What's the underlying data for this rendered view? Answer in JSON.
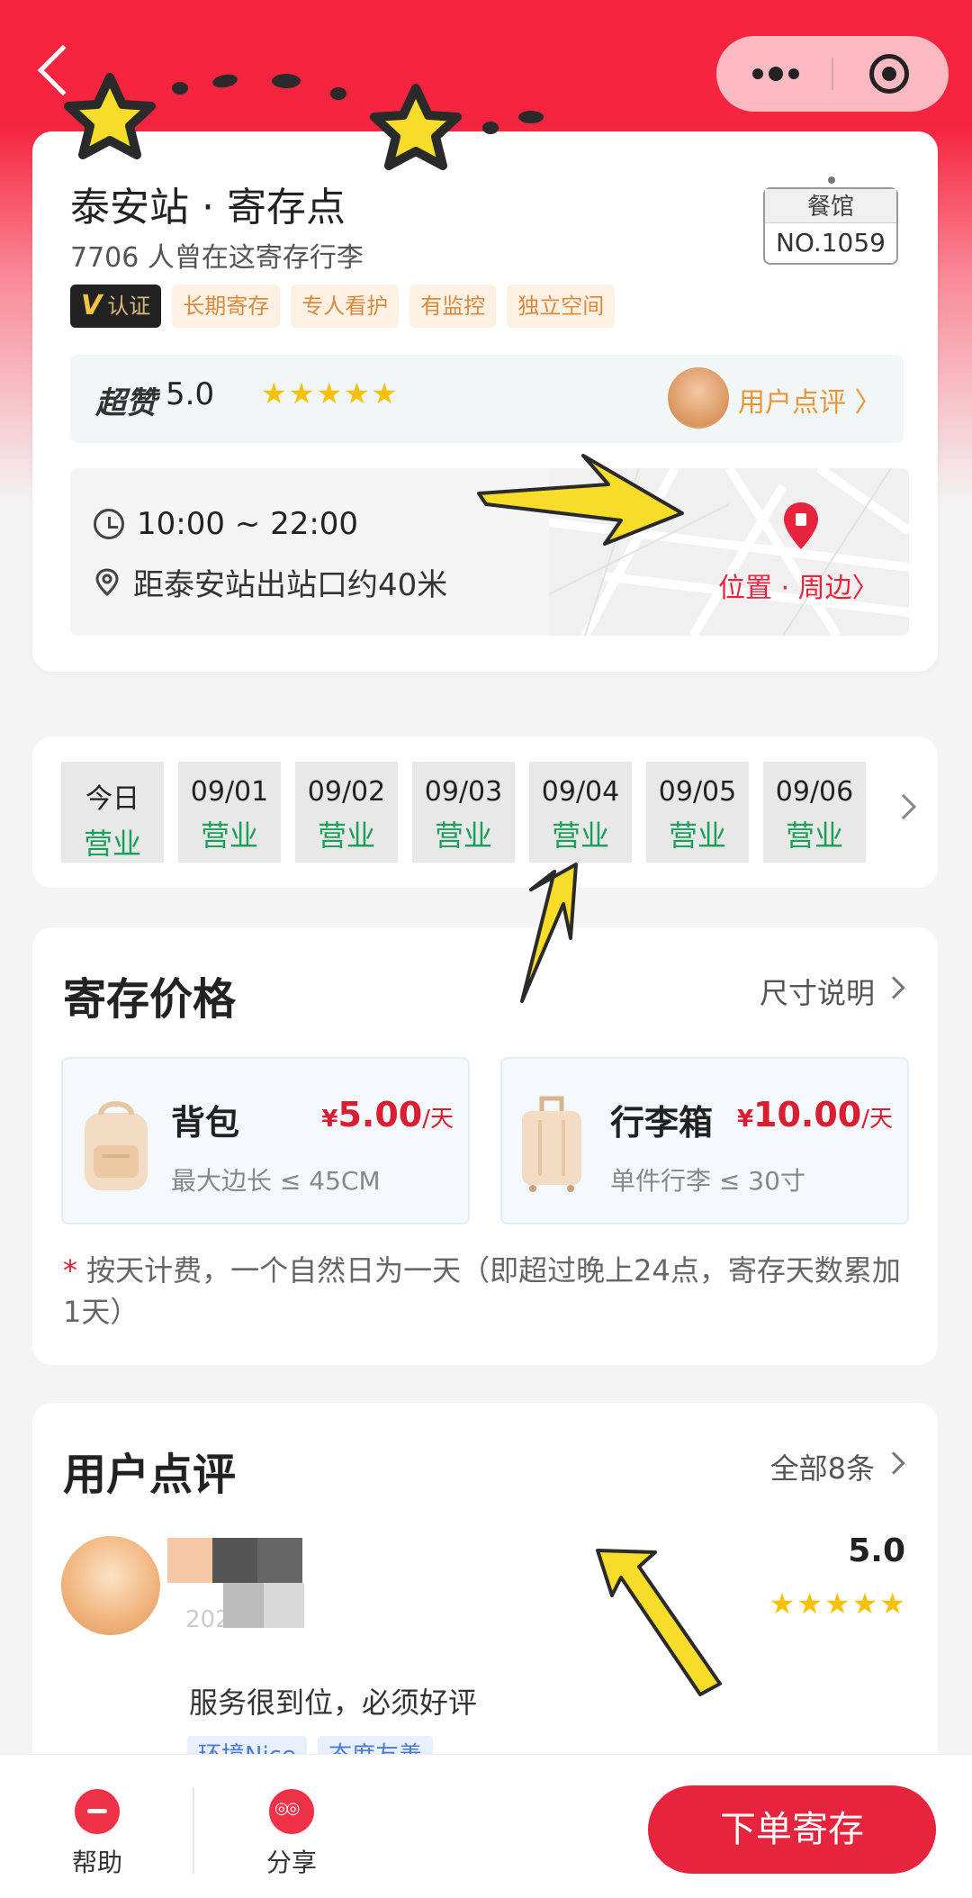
{
  "nav": {
    "back_icon": "back-arrow-icon",
    "more_icon": "more-dots-icon",
    "close_icon": "target-circle-icon"
  },
  "store": {
    "title": "泰安站 · 寄存点",
    "subtitle": "7706 人曾在这寄存行李",
    "verified_label": "认证",
    "tags": [
      "长期寄存",
      "专人看护",
      "有监控",
      "独立空间"
    ],
    "badge_top": "餐馆",
    "badge_no": "NO.1059"
  },
  "rating": {
    "label": "超赞",
    "score": "5.0",
    "stars": "★★★★★",
    "link": "用户点评 〉"
  },
  "location": {
    "hours": "10:00 ~ 22:00",
    "distance": "距泰安站出站口约40米",
    "link": "位置 · 周边〉"
  },
  "dates": [
    {
      "date": "今日",
      "status": "营业"
    },
    {
      "date": "09/01",
      "status": "营业"
    },
    {
      "date": "09/02",
      "status": "营业"
    },
    {
      "date": "09/03",
      "status": "营业"
    },
    {
      "date": "09/04",
      "status": "营业"
    },
    {
      "date": "09/05",
      "status": "营业"
    },
    {
      "date": "09/06",
      "status": "营业"
    }
  ],
  "pricing": {
    "title": "寄存价格",
    "size_link": "尺寸说明",
    "items": [
      {
        "name": "背包",
        "currency": "¥",
        "price": "5.00",
        "unit": "/天",
        "desc": "最大边长 ≤ 45CM"
      },
      {
        "name": "行李箱",
        "currency": "¥",
        "price": "10.00",
        "unit": "/天",
        "desc": "单件行李 ≤ 30寸"
      }
    ],
    "note_star": "*",
    "note": " 按天计费，一个自然日为一天（即超过晚上24点，寄存天数累加1天）"
  },
  "reviews": {
    "title": "用户点评",
    "all_link": "全部8条",
    "first": {
      "date": "2022",
      "score": "5.0",
      "stars": "★★★★★",
      "text": "服务很到位，必须好评",
      "tags": [
        "环境Nice",
        "态度友善"
      ]
    }
  },
  "bottom": {
    "help": "帮助",
    "share": "分享",
    "order": "下单寄存"
  },
  "colors": {
    "brand_red": "#f5253f",
    "open_green": "#19a15a",
    "star_yellow": "#f8c100"
  }
}
